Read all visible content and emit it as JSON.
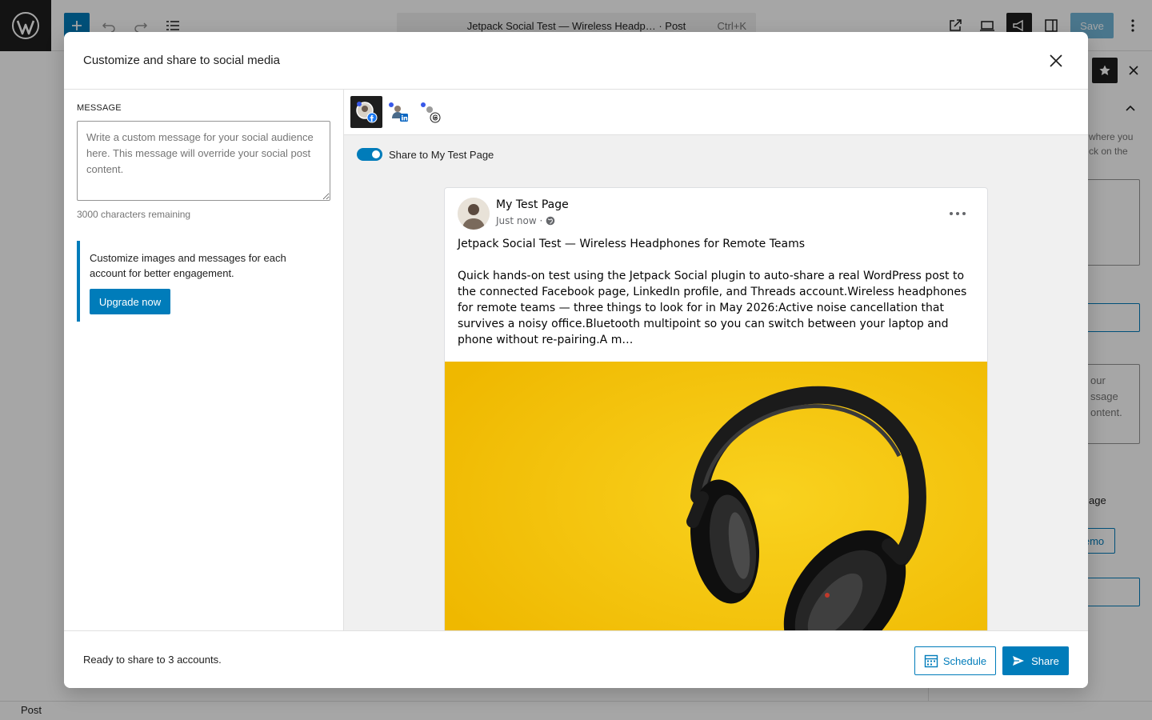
{
  "editor": {
    "document_title": "Jetpack Social Test — Wireless Headp…",
    "document_type": "· Post",
    "shortcut": "Ctrl+K",
    "save_label": "Save",
    "status_label": "Post",
    "sidebar_fragments": {
      "line1": "where you",
      "line2": "ck on the",
      "msg1": "our",
      "msg2": "ssage",
      "msg3": "ontent.",
      "page": "age",
      "demo": "emo"
    }
  },
  "modal": {
    "title": "Customize and share to social media",
    "message": {
      "label": "MESSAGE",
      "placeholder": "Write a custom message for your social audience here. This message will override your social post content.",
      "value": "",
      "chars_remaining": "3000 characters remaining"
    },
    "notice": {
      "text": "Customize images and messages for each account for better engagement.",
      "button": "Upgrade now"
    },
    "tabs": [
      {
        "network": "facebook",
        "icon": "facebook-account-icon",
        "active": true
      },
      {
        "network": "linkedin",
        "icon": "linkedin-account-icon",
        "active": false
      },
      {
        "network": "threads",
        "icon": "threads-account-icon",
        "active": false
      }
    ],
    "toggle": {
      "label": "Share to My Test Page",
      "on": true
    },
    "preview": {
      "page_name": "My Test Page",
      "timestamp": "Just now ·",
      "headline": "Jetpack Social Test — Wireless Headphones for Remote Teams",
      "body": "Quick hands-on test using the Jetpack Social plugin to auto-share a real WordPress post to the connected Facebook page, LinkedIn profile, and Threads account.Wireless headphones for remote teams — three things to look for in May 2026:Active noise cancellation that survives a noisy office.Bluetooth multipoint so you can switch between your laptop and phone without re-pairing.A m…",
      "image_description": "black headphones on yellow background"
    },
    "footer": {
      "status": "Ready to share to 3 accounts.",
      "schedule_label": "Schedule",
      "share_label": "Share"
    }
  },
  "colors": {
    "accent": "#007cba",
    "dark": "#1e1e1e",
    "facebook": "#1877f2",
    "linkedin": "#0a66c2",
    "image_bg": "#f5c40c"
  }
}
